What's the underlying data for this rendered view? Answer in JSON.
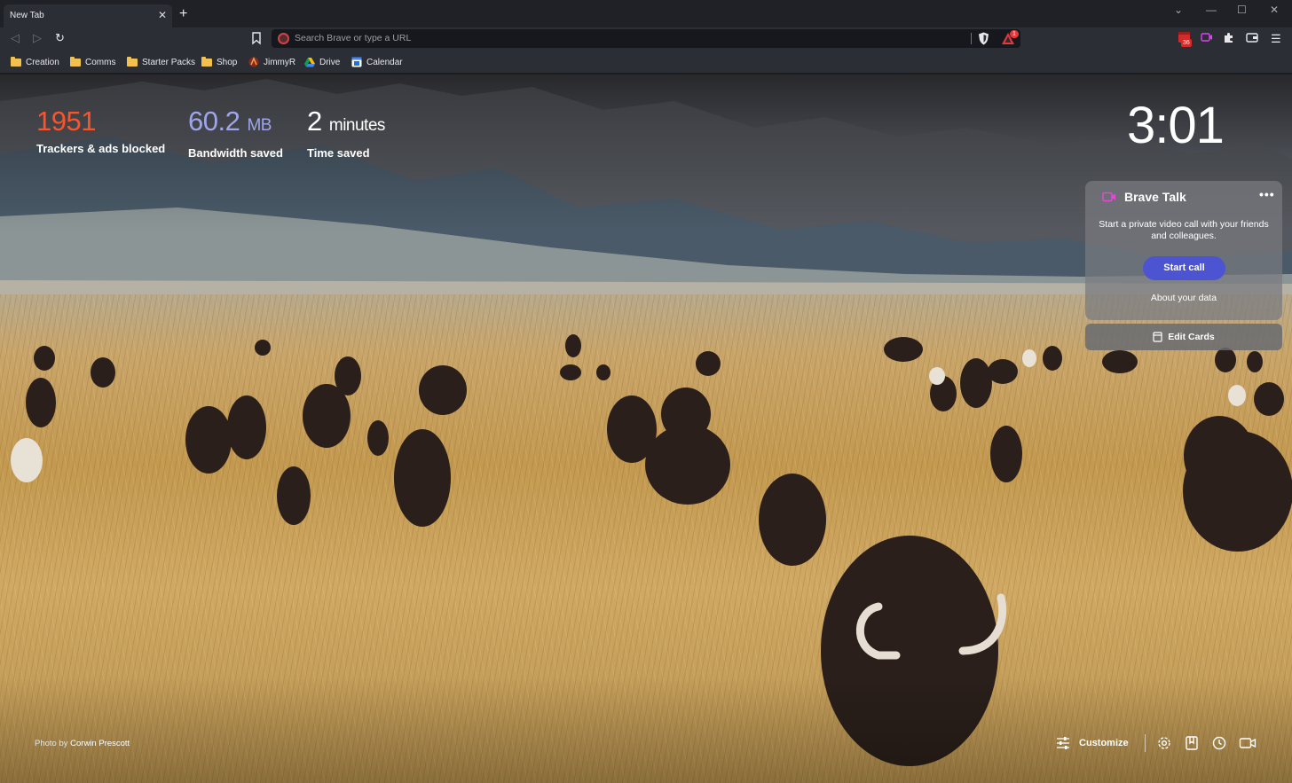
{
  "tab": {
    "title": "New Tab",
    "close": "✕",
    "new_tab": "+"
  },
  "window_controls": {
    "dropdown": "⌄",
    "minimize": "—",
    "maximize": "☐",
    "close": "✕"
  },
  "toolbar": {
    "back": "◁",
    "forward": "▷",
    "reload": "↻",
    "omnibox_placeholder": "Search Brave or type a URL",
    "rewards_badge": "1",
    "extension_badge": "36",
    "menu": "☰"
  },
  "bookmarks": [
    {
      "label": "Creation",
      "icon": "folder-icon"
    },
    {
      "label": "Comms",
      "icon": "folder-icon"
    },
    {
      "label": "Starter Packs",
      "icon": "folder-icon"
    },
    {
      "label": "Shop",
      "icon": "folder-icon"
    },
    {
      "label": "JimmyR",
      "icon": "jimmyr-favicon"
    },
    {
      "label": "Drive",
      "icon": "drive-favicon"
    },
    {
      "label": "Calendar",
      "icon": "calendar-favicon"
    }
  ],
  "stats": {
    "trackers": {
      "value": "1951",
      "label": "Trackers & ads blocked",
      "color": "#fb542b"
    },
    "bandwidth": {
      "value": "60.2",
      "unit": "MB",
      "label": "Bandwidth saved",
      "color": "#a0a5eb"
    },
    "time": {
      "value": "2",
      "unit": "minutes",
      "label": "Time saved",
      "color": "#ffffff"
    }
  },
  "clock": "3:01",
  "brave_talk": {
    "title": "Brave Talk",
    "more": "•••",
    "description": "Start a private video call with your friends and colleagues.",
    "button": "Start call",
    "about": "About your data",
    "accent": "#4c54d2"
  },
  "edit_cards": "Edit Cards",
  "photo_credit": {
    "prefix": "Photo by",
    "author": "Corwin Prescott"
  },
  "bottom": {
    "customize": "Customize"
  }
}
